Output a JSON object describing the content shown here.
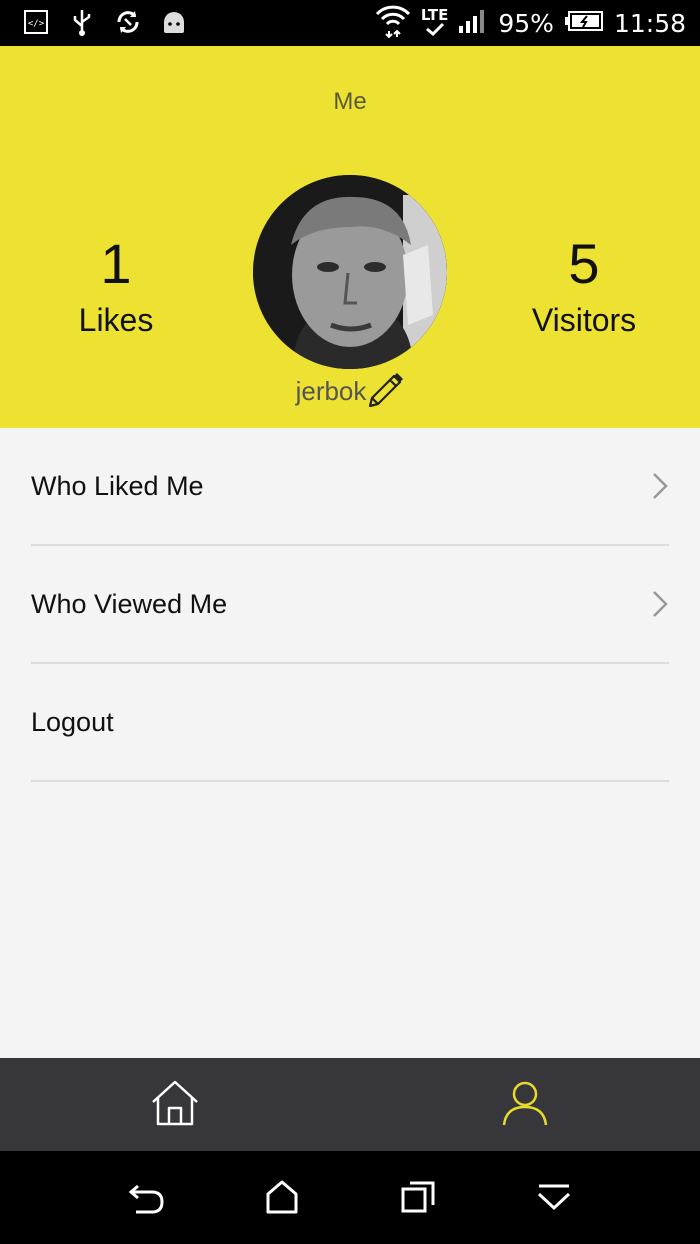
{
  "status_bar": {
    "left_icons": [
      "developer-icon",
      "usb-icon",
      "sync-icon",
      "android-icon"
    ],
    "battery_percent": "95%",
    "time": "11:58",
    "network": "LTE"
  },
  "header": {
    "title": "Me",
    "likes": {
      "value": "1",
      "label": "Likes"
    },
    "visitors": {
      "value": "5",
      "label": "Visitors"
    },
    "username": "jerbok",
    "accent_color": "#ede232"
  },
  "menu": {
    "items": [
      {
        "label": "Who Liked Me",
        "has_chevron": true
      },
      {
        "label": "Who Viewed Me",
        "has_chevron": true
      },
      {
        "label": "Logout",
        "has_chevron": false
      }
    ]
  },
  "bottom_nav": {
    "items": [
      {
        "icon": "home-icon",
        "active": false
      },
      {
        "icon": "profile-icon",
        "active": true
      }
    ],
    "active_color": "#e6db2a"
  },
  "system_nav": {
    "items": [
      "back-icon",
      "home-icon",
      "recents-icon",
      "collapse-icon"
    ]
  }
}
